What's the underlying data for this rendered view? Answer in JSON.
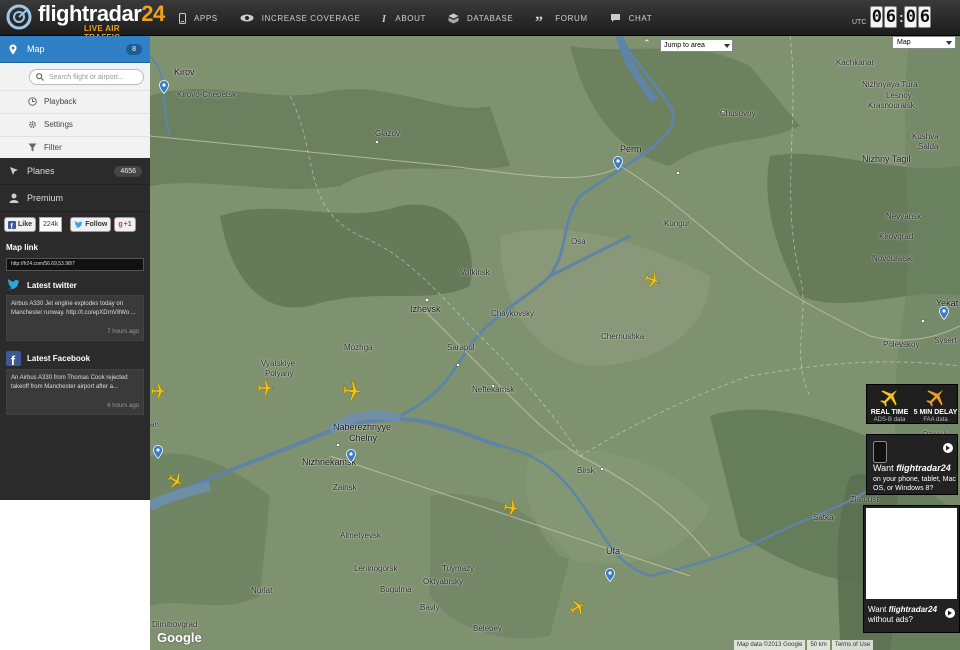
{
  "header": {
    "logo_text": "flightradar",
    "logo_num": "24",
    "tagline": "LIVE AIR TRAFFIC",
    "nav": [
      {
        "label": "APPS",
        "icon": "phone-icon"
      },
      {
        "label": "INCREASE COVERAGE",
        "icon": "eye-icon"
      },
      {
        "label": "ABOUT",
        "icon": "info-icon"
      },
      {
        "label": "DATABASE",
        "icon": "database-icon"
      },
      {
        "label": "FORUM",
        "icon": "quote-icon"
      },
      {
        "label": "CHAT",
        "icon": "chat-bubble-icon"
      }
    ],
    "clock": {
      "label": "UTC",
      "h1": "0",
      "h2": "6",
      "m1": "0",
      "m2": "6"
    }
  },
  "sidebar": {
    "map_label": "Map",
    "map_count": "8",
    "search_placeholder": "Search flight or airport...",
    "submenu": [
      {
        "label": "Playback",
        "icon": "clock-icon"
      },
      {
        "label": "Settings",
        "icon": "gear-icon"
      },
      {
        "label": "Filter",
        "icon": "filter-icon"
      }
    ],
    "planes_label": "Planes",
    "planes_count": "4656",
    "premium_label": "Premium",
    "social": {
      "like": "Like",
      "like_count": "224k",
      "follow": "Follow",
      "gplus": "+1"
    },
    "map_link_title": "Map link",
    "map_link_value": "http://fr24.com/56.69,53.98/7",
    "twitter_title": "Latest twitter",
    "twitter_text": "Airbus A330 Jet engine explodes today on Manchester runway. http://t.co/epXDrnV8Wo ...",
    "twitter_time": "7 hours ago",
    "facebook_title": "Latest Facebook",
    "facebook_text": "An Airbus A330 from Thomas Cook rejected takeoff from Manchester airport after a...",
    "facebook_time": "6 hours ago"
  },
  "map": {
    "jump_label": "Jump to area",
    "map_type": "Map",
    "cities": [
      {
        "name": "Kirov",
        "cls": "big"
      },
      {
        "name": "Kirovo-Chepetsk",
        "cls": ""
      },
      {
        "name": "Glazov",
        "cls": ""
      },
      {
        "name": "Perm",
        "cls": "big"
      },
      {
        "name": "Chusovoy",
        "cls": ""
      },
      {
        "name": "Kachkanar",
        "cls": ""
      },
      {
        "name": "Nizhnyaya Tura",
        "cls": ""
      },
      {
        "name": "Lesnoy",
        "cls": ""
      },
      {
        "name": "Krasnouralsk",
        "cls": ""
      },
      {
        "name": "Kushva",
        "cls": ""
      },
      {
        "name": "Salda",
        "cls": ""
      },
      {
        "name": "Nizhny Tagil",
        "cls": "big"
      },
      {
        "name": "Kungur",
        "cls": ""
      },
      {
        "name": "Osa",
        "cls": ""
      },
      {
        "name": "Nevyansk",
        "cls": ""
      },
      {
        "name": "Kirovgrad",
        "cls": ""
      },
      {
        "name": "Novouralsk",
        "cls": ""
      },
      {
        "name": "Votkinsk",
        "cls": ""
      },
      {
        "name": "Izhevsk",
        "cls": "big"
      },
      {
        "name": "Chaykovsky",
        "cls": ""
      },
      {
        "name": "Yekat",
        "cls": "big"
      },
      {
        "name": "Chernushka",
        "cls": ""
      },
      {
        "name": "Sysert",
        "cls": ""
      },
      {
        "name": "Polevskoy",
        "cls": ""
      },
      {
        "name": "Mozhga",
        "cls": ""
      },
      {
        "name": "Sarapul",
        "cls": ""
      },
      {
        "name": "Vyatskiye",
        "cls": ""
      },
      {
        "name": "Polyany",
        "cls": ""
      },
      {
        "name": "Neftekamsk",
        "cls": ""
      },
      {
        "name": "Naberezhnyye",
        "cls": "big"
      },
      {
        "name": "Chelny",
        "cls": "big"
      },
      {
        "name": "Nizhnekamsk",
        "cls": "big"
      },
      {
        "name": "Ozersk",
        "cls": ""
      },
      {
        "name": "Birsk",
        "cls": ""
      },
      {
        "name": "Zainsk",
        "cls": ""
      },
      {
        "name": "Zlatoust",
        "cls": ""
      },
      {
        "name": "Satka",
        "cls": ""
      },
      {
        "name": "Almetyevsk",
        "cls": ""
      },
      {
        "name": "Ufa",
        "cls": "big"
      },
      {
        "name": "Leninogorsk",
        "cls": ""
      },
      {
        "name": "Tuymazy",
        "cls": ""
      },
      {
        "name": "Oktyabrsky",
        "cls": ""
      },
      {
        "name": "Bugulma",
        "cls": ""
      },
      {
        "name": "Nurlat",
        "cls": ""
      },
      {
        "name": "Bavly",
        "cls": ""
      },
      {
        "name": "Belebey",
        "cls": ""
      },
      {
        "name": "Dimitrovgrad",
        "cls": ""
      },
      {
        "name": "an",
        "cls": ""
      }
    ],
    "promo_rt_title": "REAL TIME",
    "promo_rt_sub": "ADS-B data",
    "promo_delay_title": "5 MIN DELAY",
    "promo_delay_sub": "FAA data",
    "promo_want": "Want",
    "promo_brand": "flightradar24",
    "promo_platforms": "on your phone, tablet, Mac OS, or Windows 8?",
    "promo_noads": "without ads?",
    "google": "Google",
    "map_data": "Map data ©2013 Google",
    "scale": "50 km",
    "terms": "Terms of Use"
  }
}
